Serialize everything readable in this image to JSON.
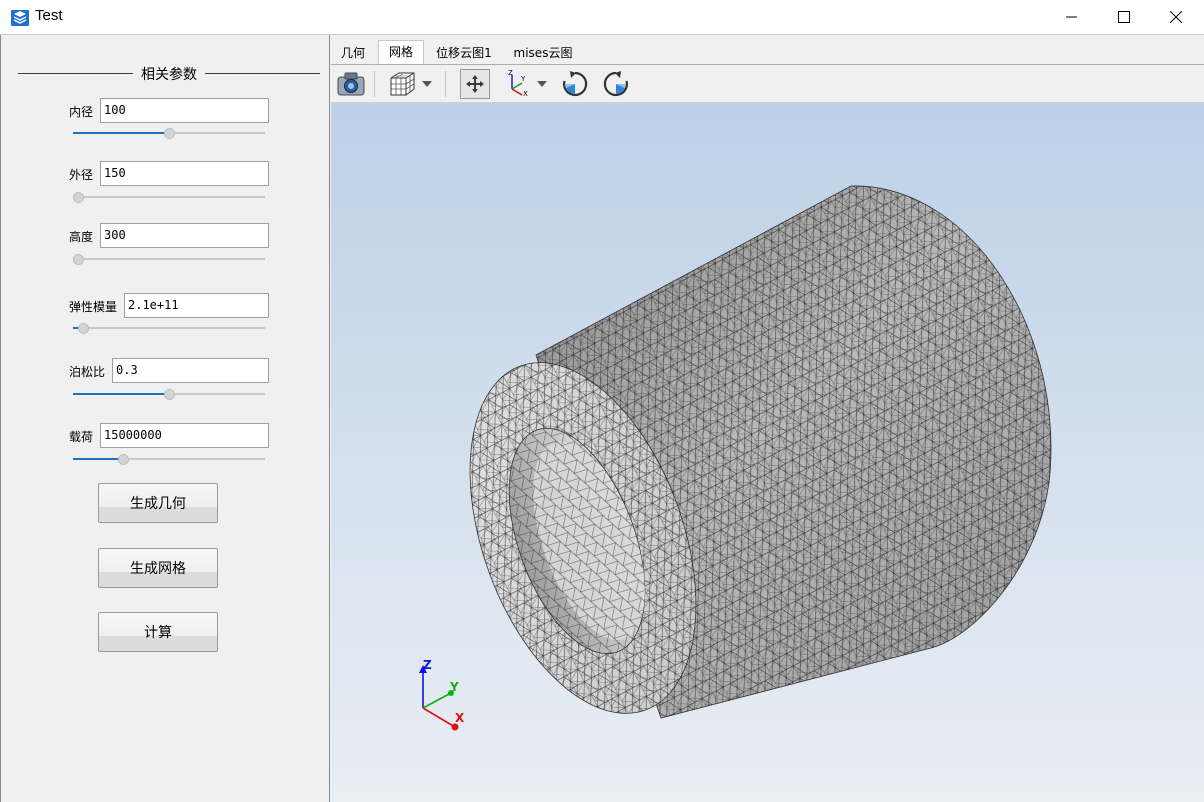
{
  "window": {
    "title": "Test"
  },
  "params": {
    "group_title": "相关参数",
    "fields": [
      {
        "label": "内径",
        "value": "100",
        "slider_fraction": 0.5
      },
      {
        "label": "外径",
        "value": "150",
        "slider_fraction": 0.0
      },
      {
        "label": "高度",
        "value": "300",
        "slider_fraction": 0.0
      },
      {
        "label": "弹性模量",
        "value": "2.1e+11",
        "slider_fraction": 0.03
      },
      {
        "label": "泊松比",
        "value": "0.3",
        "slider_fraction": 0.5
      },
      {
        "label": "载荷",
        "value": "15000000",
        "slider_fraction": 0.25
      }
    ],
    "buttons": {
      "geometry": "生成几何",
      "mesh": "生成网格",
      "compute": "计算"
    }
  },
  "tabs": [
    {
      "label": "几何",
      "active": false
    },
    {
      "label": "网格",
      "active": true
    },
    {
      "label": "位移云图1",
      "active": false
    },
    {
      "label": "mises云图",
      "active": false
    }
  ],
  "toolbar": {
    "icons": [
      "camera-icon",
      "cube-view-icon",
      "dropdown-arrow-icon",
      "fit-view-icon",
      "axes-icon",
      "dropdown-arrow-icon",
      "rotate-left-icon",
      "rotate-right-icon"
    ]
  },
  "viewport": {
    "axes": {
      "x": "X",
      "y": "Y",
      "z": "Z"
    },
    "axis_colors": {
      "x": "#e01010",
      "y": "#10b010",
      "z": "#1010e0"
    }
  },
  "colors": {
    "accent": "#1f6fbf",
    "viewport_top": "#bcd0e6",
    "viewport_bottom": "#e9eef4"
  }
}
